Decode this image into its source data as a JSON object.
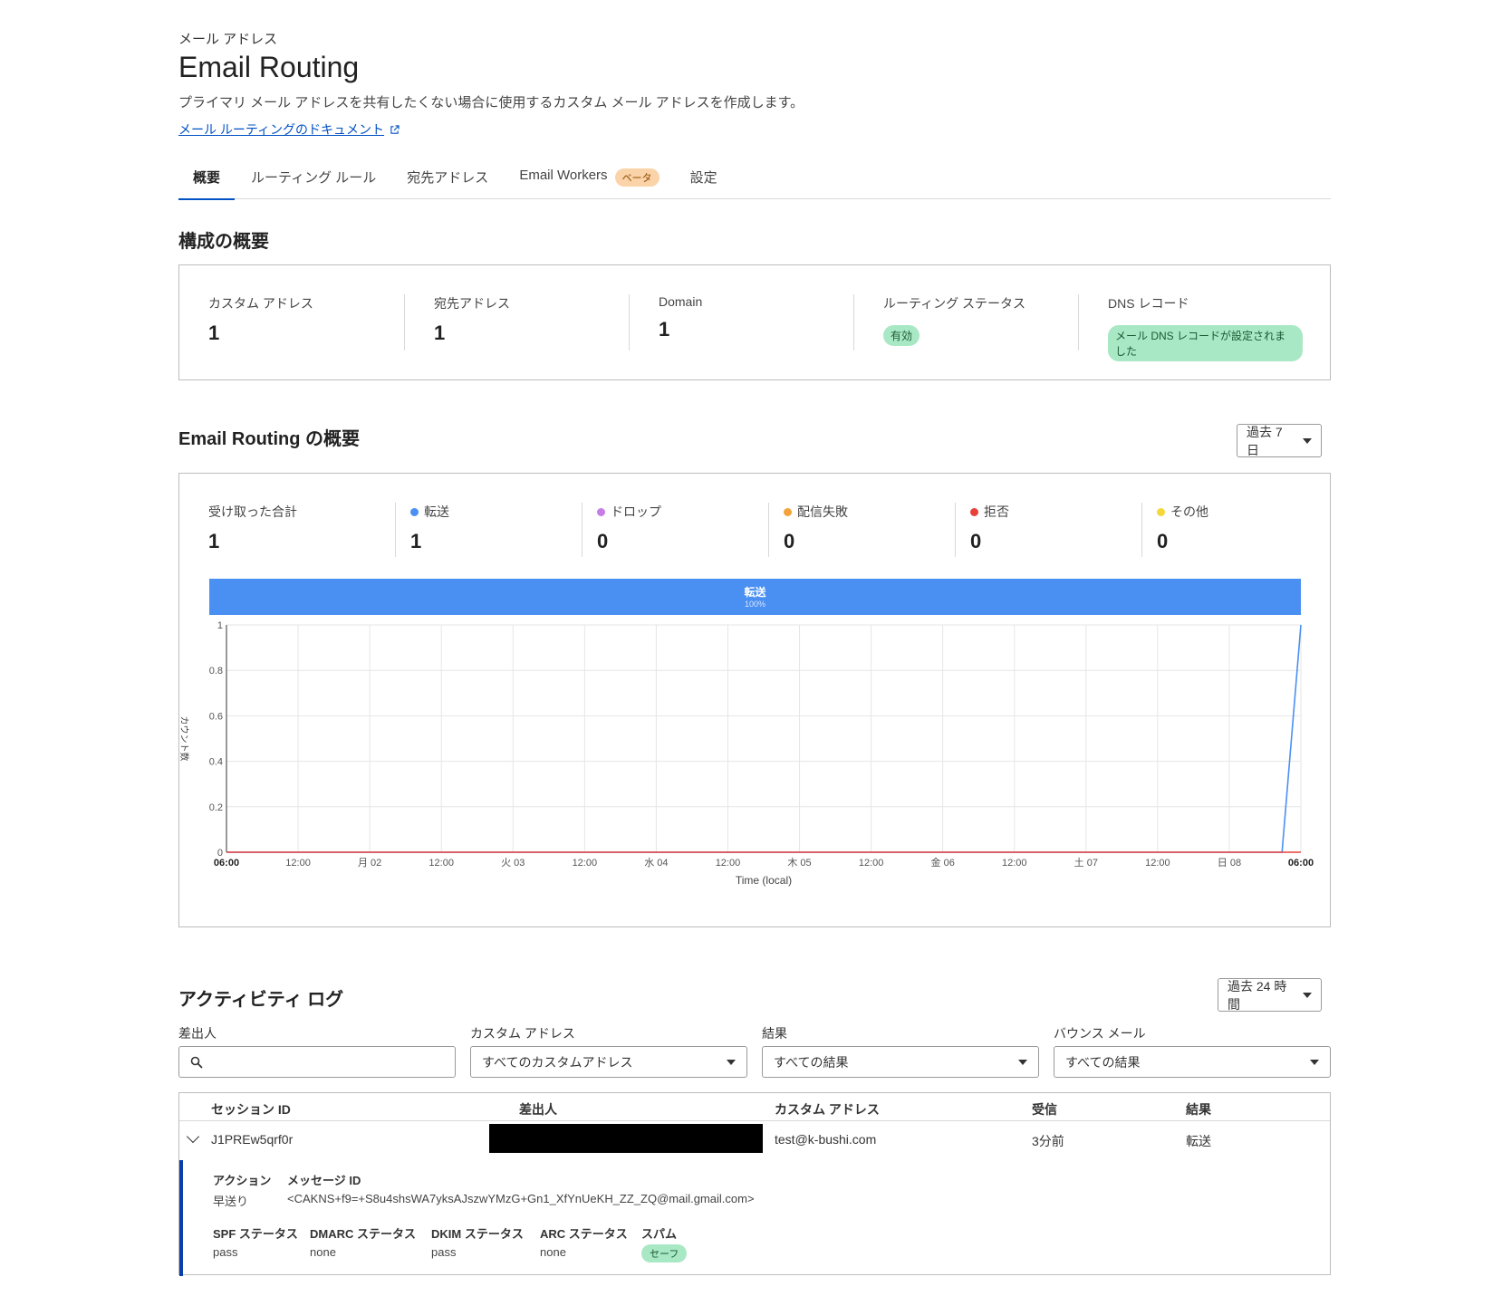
{
  "header": {
    "eyebrow": "メール アドレス",
    "title": "Email Routing",
    "description": "プライマリ メール アドレスを共有したくない場合に使用するカスタム メール アドレスを作成します。",
    "doc_link": "メール ルーティングのドキュメント"
  },
  "tabs": [
    {
      "label": "概要"
    },
    {
      "label": "ルーティング ルール"
    },
    {
      "label": "宛先アドレス"
    },
    {
      "label": "Email Workers",
      "badge": "ベータ"
    },
    {
      "label": "設定"
    }
  ],
  "config": {
    "title": "構成の概要",
    "items": [
      {
        "label": "カスタム アドレス",
        "value": "1"
      },
      {
        "label": "宛先アドレス",
        "value": "1"
      },
      {
        "label": "Domain",
        "value": "1"
      },
      {
        "label": "ルーティング ステータス",
        "pill": "有効"
      },
      {
        "label": "DNS レコード",
        "pill": "メール DNS レコードが設定されました"
      }
    ]
  },
  "overview": {
    "title": "Email Routing の概要",
    "range": "過去 7 日",
    "stats": [
      {
        "label": "受け取った合計",
        "value": "1",
        "color": ""
      },
      {
        "label": "転送",
        "value": "1",
        "color": "#4a90f2"
      },
      {
        "label": "ドロップ",
        "value": "0",
        "color": "#c77de8"
      },
      {
        "label": "配信失敗",
        "value": "0",
        "color": "#f2a33a"
      },
      {
        "label": "拒否",
        "value": "0",
        "color": "#e8413b"
      },
      {
        "label": "その他",
        "value": "0",
        "color": "#f5d73a"
      }
    ],
    "share_bar": {
      "label": "転送",
      "percent": "100%",
      "fraction": 1.0
    }
  },
  "chart_data": {
    "type": "line",
    "xlabel": "Time (local)",
    "ylabel": "カウント数",
    "ylim": [
      0,
      1
    ],
    "yticks": [
      "0",
      "0.2",
      "0.4",
      "0.6",
      "0.8",
      "1"
    ],
    "xticks": [
      "06:00",
      "12:00",
      "月 02",
      "12:00",
      "火 03",
      "12:00",
      "水 04",
      "12:00",
      "木 05",
      "12:00",
      "金 06",
      "12:00",
      "土 07",
      "12:00",
      "日 08",
      "06:00"
    ],
    "bold_xticks": [
      0,
      15
    ],
    "series": [
      {
        "color": "#4a90f2",
        "values": [
          0,
          0,
          0,
          0,
          0,
          0,
          0,
          0,
          0,
          0,
          0,
          0,
          0,
          0,
          0,
          0,
          0,
          0,
          0,
          0,
          0,
          0,
          0,
          0,
          0,
          0,
          0,
          0,
          0,
          0,
          0,
          0,
          0,
          0,
          0,
          0,
          0,
          0,
          0,
          0,
          0,
          0,
          0,
          0,
          0,
          0,
          0,
          0,
          0,
          0,
          0,
          0,
          0,
          0,
          0,
          0,
          0,
          1
        ]
      },
      {
        "color": "#e8413b",
        "values": [
          0,
          0,
          0,
          0,
          0,
          0,
          0,
          0,
          0,
          0,
          0,
          0,
          0,
          0,
          0,
          0,
          0,
          0,
          0,
          0,
          0,
          0,
          0,
          0,
          0,
          0,
          0,
          0,
          0,
          0,
          0,
          0,
          0,
          0,
          0,
          0,
          0,
          0,
          0,
          0,
          0,
          0,
          0,
          0,
          0,
          0,
          0,
          0,
          0,
          0,
          0,
          0,
          0,
          0,
          0,
          0,
          0,
          0
        ]
      }
    ],
    "grid": true
  },
  "activity": {
    "title": "アクティビティ ログ",
    "range": "過去 24 時間",
    "filters": [
      {
        "label": "差出人",
        "value": ""
      },
      {
        "label": "カスタム アドレス",
        "value": "すべてのカスタムアドレス"
      },
      {
        "label": "結果",
        "value": "すべての結果"
      },
      {
        "label": "バウンス メール",
        "value": "すべての結果"
      }
    ],
    "columns": [
      "セッション ID",
      "差出人",
      "カスタム アドレス",
      "受信",
      "結果"
    ],
    "rows": [
      {
        "session_id": "J1PREw5qrf0r",
        "sender": "",
        "custom_address": "test@k-bushi.com",
        "received": "3分前",
        "result": "転送"
      }
    ],
    "detail": {
      "action_label": "アクション",
      "action_value": "早送り",
      "message_id_label": "メッセージ ID",
      "message_id_value": "<CAKNS+f9=+S8u4shsWA7yksAJszwYMzG+Gn1_XfYnUeKH_ZZ_ZQ@mail.gmail.com>",
      "spf_label": "SPF ステータス",
      "spf_value": "pass",
      "dmarc_label": "DMARC ステータス",
      "dmarc_value": "none",
      "dkim_label": "DKIM ステータス",
      "dkim_value": "pass",
      "arc_label": "ARC ステータス",
      "arc_value": "none",
      "spam_label": "スパム",
      "spam_value": "セーフ"
    }
  }
}
